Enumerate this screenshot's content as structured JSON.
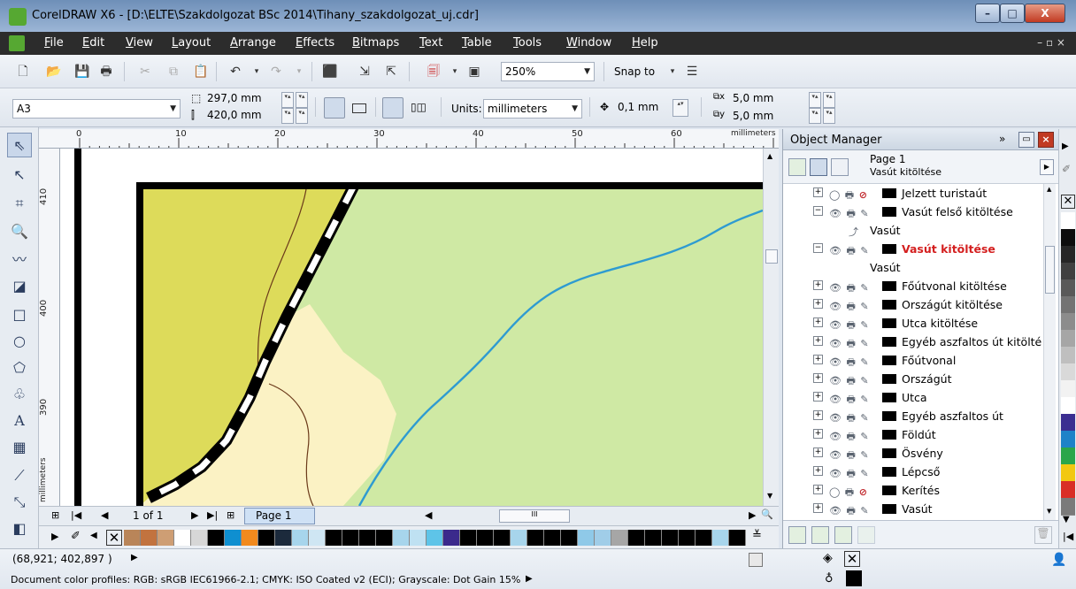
{
  "window": {
    "title": "CorelDRAW X6 - [D:\\ELTE\\Szakdolgozat BSc 2014\\Tihany_szakdolgozat_uj.cdr]",
    "min_glyph": "–",
    "max_glyph": "□",
    "close_glyph": "X"
  },
  "menu": {
    "items": [
      "File",
      "Edit",
      "View",
      "Layout",
      "Arrange",
      "Effects",
      "Bitmaps",
      "Text",
      "Table",
      "Tools",
      "Window",
      "Help"
    ],
    "mdi_controls": "– ▫ ×"
  },
  "toolbar": {
    "zoom": "250%",
    "snap_to": "Snap to"
  },
  "property_bar": {
    "page_size": "A3",
    "width": "297,0 mm",
    "height": "420,0 mm",
    "units_label": "Units:",
    "units_value": "millimeters",
    "nudge": "0,1 mm",
    "dup_x": "5,0 mm",
    "dup_y": "5,0 mm"
  },
  "ruler": {
    "top_labels": [
      "0",
      "10",
      "20",
      "30",
      "40",
      "50",
      "60"
    ],
    "units": "millimeters",
    "left_labels": [
      "410",
      "400",
      "390"
    ],
    "left_units": "millimeters"
  },
  "navigator": {
    "page_count": "1 of 1",
    "page_tab": "Page 1"
  },
  "object_manager": {
    "title": "Object Manager",
    "page": "Page 1",
    "current_layer": "Vasút kitöltése",
    "rows": [
      {
        "label": "Jelzett turistaút",
        "type": "layer"
      },
      {
        "label": "Vasút felső kitöltése",
        "type": "layer"
      },
      {
        "label": "Vasút",
        "type": "object"
      },
      {
        "label": "Vasút kitöltése",
        "type": "active"
      },
      {
        "label": "Vasút",
        "type": "object"
      },
      {
        "label": "Főútvonal kitöltése",
        "type": "layer"
      },
      {
        "label": "Országút kitöltése",
        "type": "layer"
      },
      {
        "label": "Utca kitöltése",
        "type": "layer"
      },
      {
        "label": "Egyéb aszfaltos út kitölté",
        "type": "layer"
      },
      {
        "label": "Főútvonal",
        "type": "layer"
      },
      {
        "label": "Országút",
        "type": "layer"
      },
      {
        "label": "Utca",
        "type": "layer"
      },
      {
        "label": "Egyéb aszfaltos út",
        "type": "layer"
      },
      {
        "label": "Földút",
        "type": "layer"
      },
      {
        "label": "Ösvény",
        "type": "layer"
      },
      {
        "label": "Lépcső",
        "type": "layer"
      },
      {
        "label": "Kerítés",
        "type": "layer"
      },
      {
        "label": "Vasút",
        "type": "layer"
      }
    ]
  },
  "status": {
    "coords": "(68,921; 402,897 )",
    "profiles": "Document color profiles: RGB: sRGB IEC61966-2.1; CMYK: ISO Coated v2 (ECI); Grayscale: Dot Gain 15%"
  },
  "colors": {
    "map_yellow": "#dddb5a",
    "map_green": "#cfe9a4",
    "map_cream": "#fbf2c4",
    "river_blue": "#2e9bd1",
    "bottom_palette": [
      "#b98559",
      "#c2733f",
      "#ce9e74",
      "#ffffff",
      "#d7d7d7",
      "#000000",
      "#0f8fd0",
      "#f28a1e",
      "#000000",
      "#1c2a3c",
      "#a7d5ec",
      "#cfe6f3",
      "#000000",
      "#000000",
      "#000000",
      "#000000",
      "#a7d5ec",
      "#bfe1f2",
      "#5ec4e8",
      "#3b2a8c",
      "#000000",
      "#000000",
      "#000000",
      "#a7d5ec",
      "#000000",
      "#000000",
      "#000000",
      "#8fc9e8",
      "#a0cde8",
      "#a6a6a6",
      "#000000",
      "#000000",
      "#000000",
      "#000000",
      "#000000",
      "#a7d5ec",
      "#000000"
    ],
    "right_palette": [
      "#ffffff",
      "#0d0d0d",
      "#262626",
      "#404040",
      "#595959",
      "#737373",
      "#8c8c8c",
      "#a6a6a6",
      "#bfbfbf",
      "#d9d9d9",
      "#f2f2f2",
      "#ffffff",
      "#3b2e91",
      "#1e82c8",
      "#2aa64a",
      "#f2c811",
      "#d92e26",
      "#7a7a7a"
    ]
  }
}
